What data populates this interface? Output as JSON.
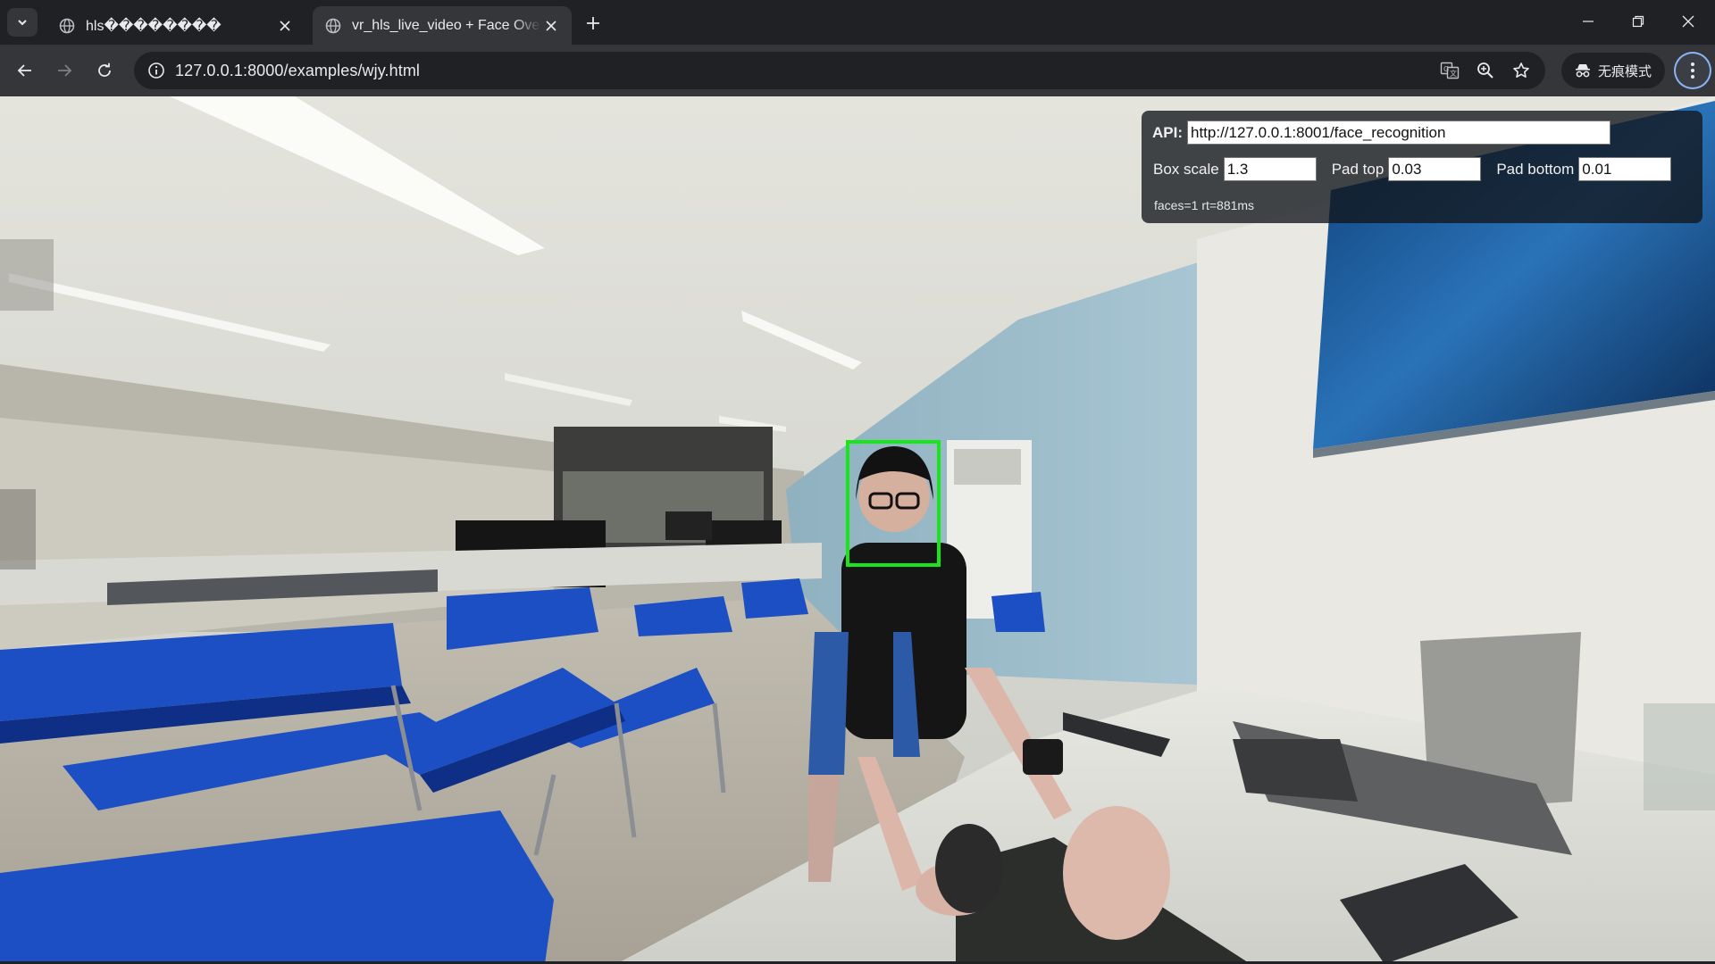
{
  "browser": {
    "tabs": [
      {
        "title": "hls\u0000\u0000\u0000\u0000\u0000\u0000\u0000\u0000",
        "display": "hls��������",
        "active": false
      },
      {
        "title": "vr_hls_live_video + Face Overlay",
        "display": "vr_hls_live_video + Face Over",
        "active": true
      }
    ],
    "url": "127.0.0.1:8000/examples/wjy.html",
    "incognito_label": "无痕模式",
    "accent": "#8ab4f8"
  },
  "overlay": {
    "api_label": "API:",
    "api_value": "http://127.0.0.1:8001/face_recognition",
    "box_scale_label": "Box scale",
    "box_scale_value": "1.3",
    "pad_top_label": "Pad top",
    "pad_top_value": "0.03",
    "pad_bottom_label": "Pad bottom",
    "pad_bottom_value": "0.01",
    "status": "faces=1 rt=881ms",
    "box_color": "#19e619"
  }
}
